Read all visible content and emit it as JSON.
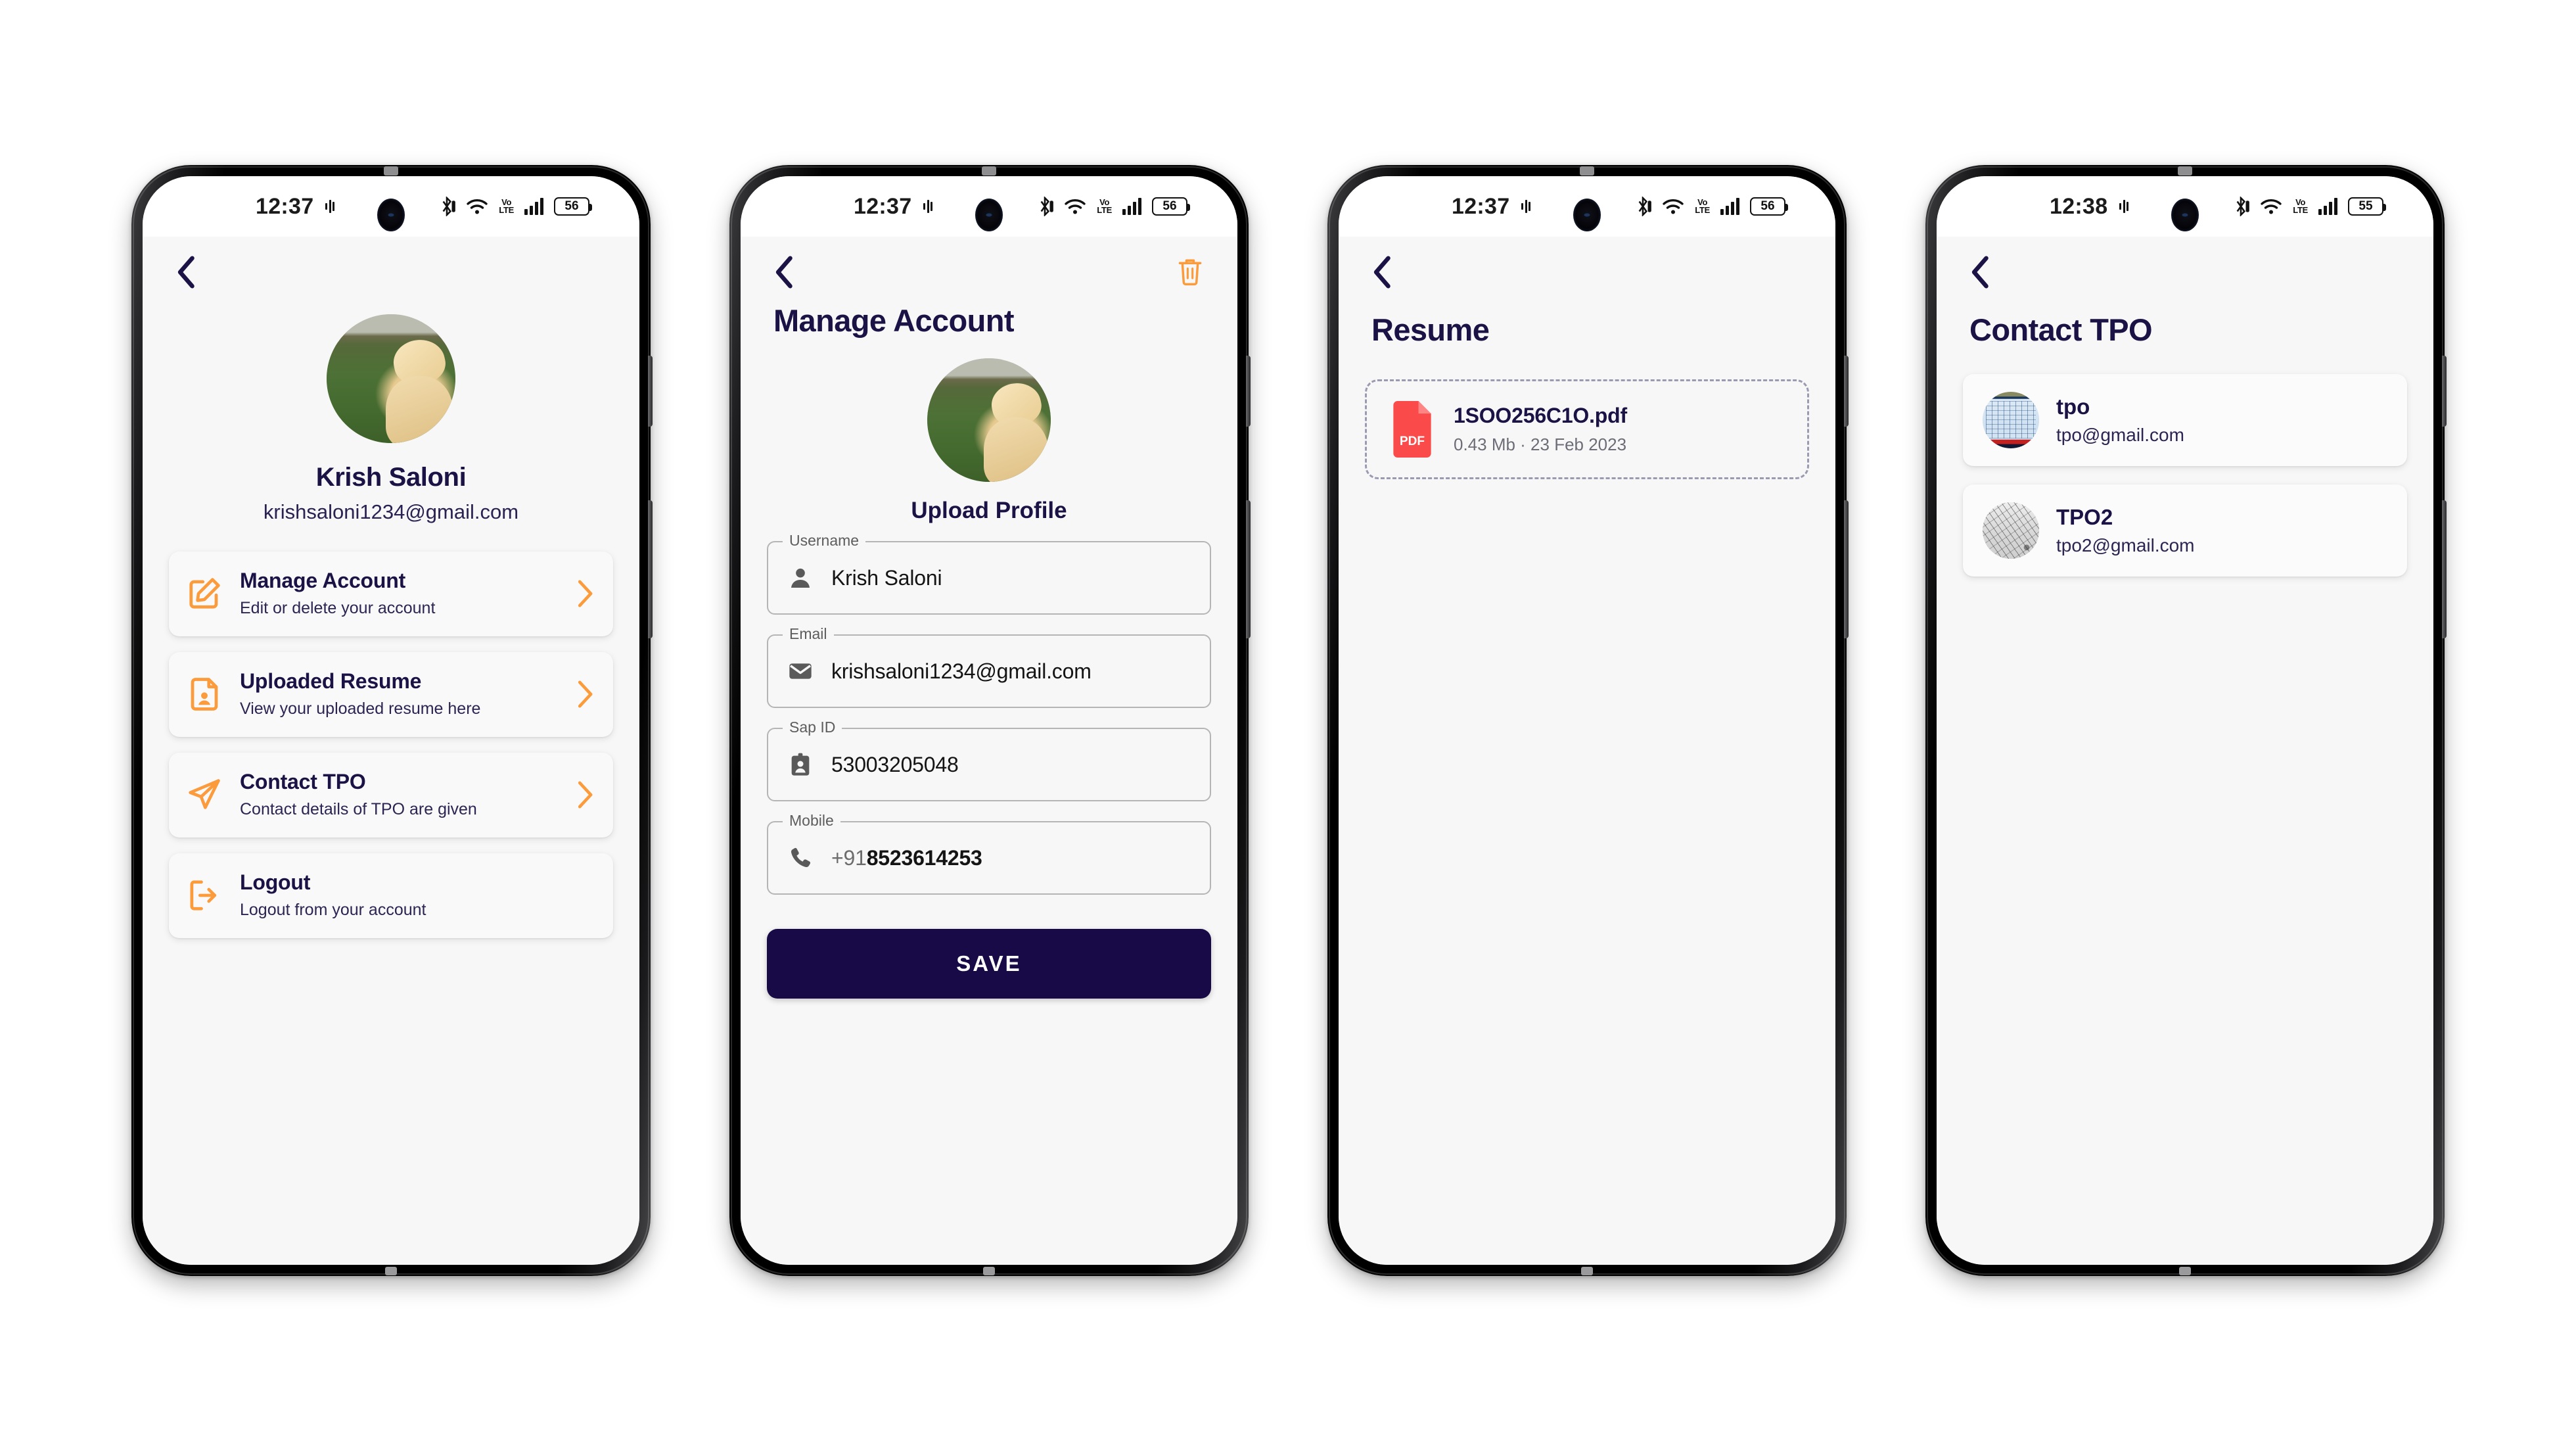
{
  "colors": {
    "accent_orange": "#FB9B3C",
    "navy": "#1B1346",
    "save_button": "#180A47",
    "screen_bg": "#F7F7F7",
    "pdf_red": "#FB4A4A"
  },
  "phones": [
    {
      "status_bar": {
        "time": "12:37",
        "battery": "56",
        "network": "VoLTE"
      },
      "screen_name": "profile",
      "back_label": "Back",
      "profile": {
        "name": "Krish Saloni",
        "email": "krishsaloni1234@gmail.com",
        "avatar_alt": "golden-retriever-puppy"
      },
      "menu": [
        {
          "title": "Manage Account",
          "subtitle": "Edit or delete your account",
          "icon": "edit-square-icon"
        },
        {
          "title": "Uploaded Resume",
          "subtitle": "View your uploaded resume here",
          "icon": "id-card-icon"
        },
        {
          "title": "Contact TPO",
          "subtitle": "Contact details of TPO are given",
          "icon": "paper-plane-icon"
        },
        {
          "title": "Logout",
          "subtitle": "Logout from your account",
          "icon": "logout-icon"
        }
      ]
    },
    {
      "status_bar": {
        "time": "12:37",
        "battery": "56",
        "network": "VoLTE"
      },
      "screen_name": "manage-account",
      "title": "Manage Account",
      "delete_icon": "trash-icon",
      "upload_label": "Upload Profile",
      "fields": [
        {
          "label": "Username",
          "value": "Krish Saloni",
          "icon": "person-icon"
        },
        {
          "label": "Email",
          "value": "krishsaloni1234@gmail.com",
          "icon": "envelope-icon"
        },
        {
          "label": "Sap ID",
          "value": "53003205048",
          "icon": "badge-icon"
        },
        {
          "label": "Mobile",
          "value": "8523614253",
          "prefix": "+91",
          "icon": "phone-icon"
        }
      ],
      "save_label": "SAVE"
    },
    {
      "status_bar": {
        "time": "12:37",
        "battery": "56",
        "network": "VoLTE"
      },
      "screen_name": "resume",
      "title": "Resume",
      "file": {
        "name": "1SOO256C1O.pdf",
        "meta": "0.43 Mb · 23 Feb 2023",
        "badge": "PDF"
      }
    },
    {
      "status_bar": {
        "time": "12:38",
        "battery": "55",
        "network": "VoLTE"
      },
      "screen_name": "contact-tpo",
      "title": "Contact TPO",
      "contacts": [
        {
          "name": "tpo",
          "email": "tpo@gmail.com",
          "avatar_alt": "spreadsheet-thumbnail"
        },
        {
          "name": "TPO2",
          "email": "tpo2@gmail.com",
          "avatar_alt": "sketch-thumbnail"
        }
      ]
    }
  ]
}
